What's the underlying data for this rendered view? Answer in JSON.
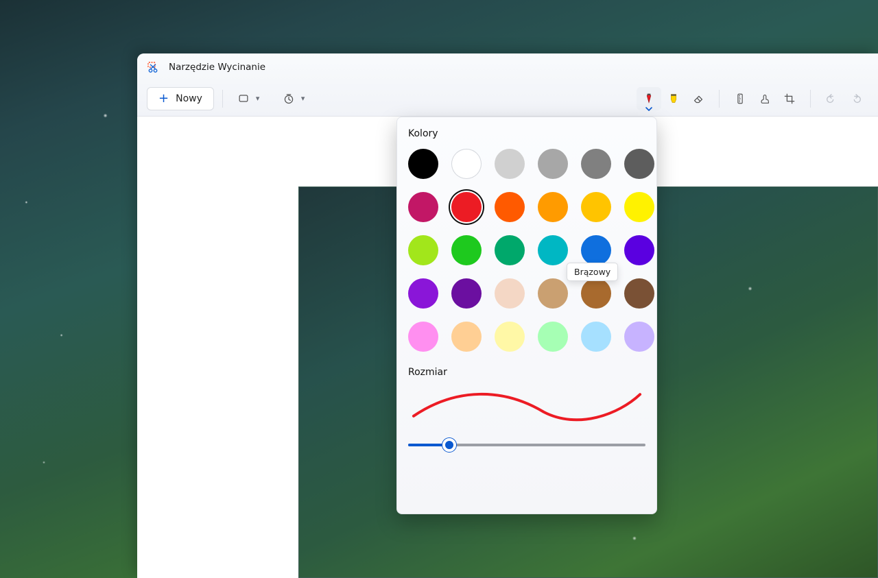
{
  "app": {
    "title": "Narzędzie Wycinanie"
  },
  "toolbar": {
    "new_label": "Nowy"
  },
  "popover": {
    "colors_heading": "Kolory",
    "size_heading": "Rozmiar",
    "tooltip": "Brązowy",
    "selected_color_index": 7,
    "tooltip_target_index": 22,
    "colors": [
      "#000000",
      "#ffffff",
      "#d0d0d0",
      "#a7a7a7",
      "#808080",
      "#5d5d5d",
      "#c21766",
      "#ec1c24",
      "#ff5a00",
      "#ff9b00",
      "#ffc400",
      "#fff200",
      "#a2e61b",
      "#1ec91e",
      "#00a86b",
      "#00b7c3",
      "#0f6fde",
      "#5a00e0",
      "#8a16d8",
      "#6b0fa0",
      "#f4d7c5",
      "#caa071",
      "#a86a2e",
      "#7a5135",
      "#ff8ff0",
      "#ffcf94",
      "#fff8a6",
      "#a6ffb4",
      "#a6e0ff",
      "#c7b3ff"
    ],
    "color_names": [
      "black",
      "white",
      "lightgray",
      "silver",
      "gray",
      "dimgray",
      "magenta",
      "red",
      "orangered",
      "orange",
      "amber",
      "yellow",
      "lime",
      "green",
      "teal",
      "cyan",
      "blue",
      "indigo",
      "violet",
      "purple",
      "bisque",
      "tan",
      "brown",
      "darkbrown",
      "pink-light",
      "peach-light",
      "yellow-light",
      "green-light",
      "blue-light",
      "purple-light"
    ],
    "slider": {
      "min": 1,
      "max": 24,
      "value": 5
    },
    "stroke_color": "#ec1c24"
  }
}
